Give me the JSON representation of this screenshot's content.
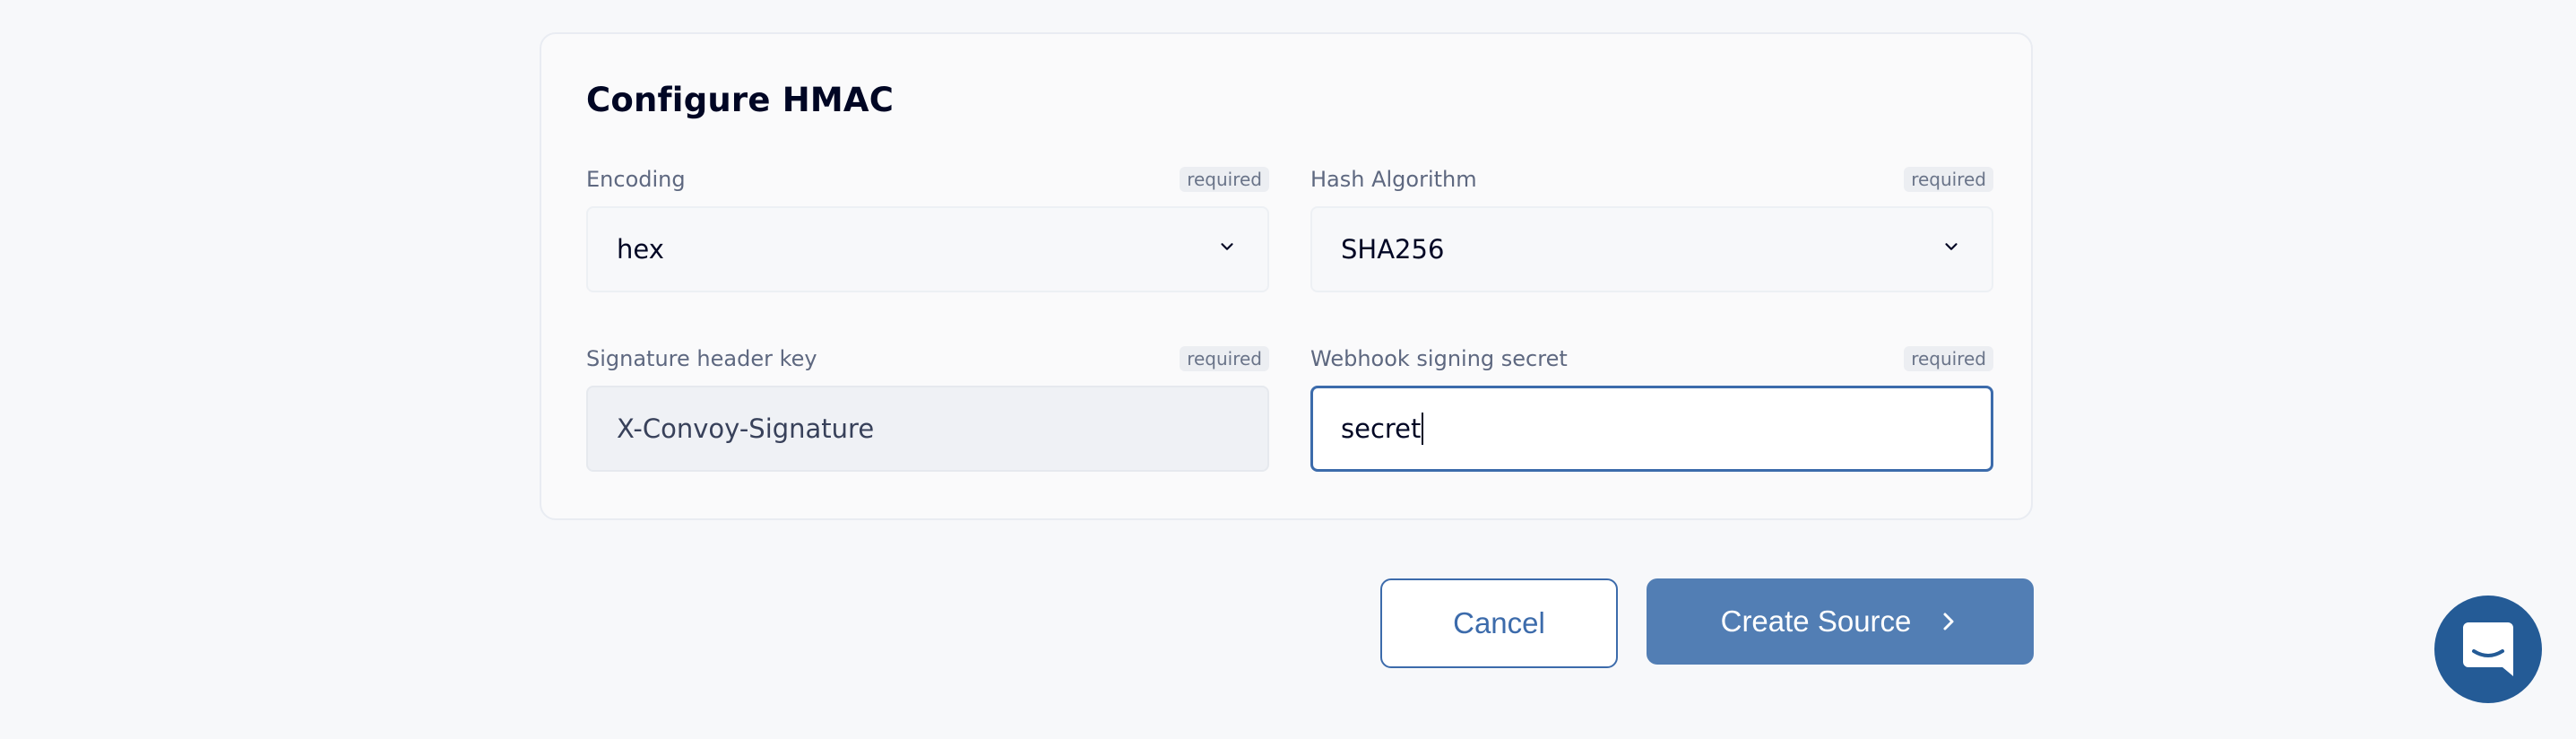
{
  "form": {
    "title": "Configure HMAC",
    "encoding": {
      "label": "Encoding",
      "required": "required",
      "value": "hex"
    },
    "hash_algorithm": {
      "label": "Hash Algorithm",
      "required": "required",
      "value": "SHA256"
    },
    "signature_header_key": {
      "label": "Signature header key",
      "required": "required",
      "value": "X-Convoy-Signature",
      "disabled": true
    },
    "webhook_signing_secret": {
      "label": "Webhook signing secret",
      "required": "required",
      "value": "secret",
      "focused": true
    }
  },
  "actions": {
    "cancel_label": "Cancel",
    "create_label": "Create Source"
  },
  "icons": {
    "select_chevron": "chevron-down-icon",
    "create_arrow": "chevron-right-icon",
    "chat": "chat-icon"
  },
  "colors": {
    "primary": "#3c6bab",
    "primary_button": "#527eb4",
    "chat_launcher": "#245b96",
    "page_background": "#f7f8fa"
  }
}
